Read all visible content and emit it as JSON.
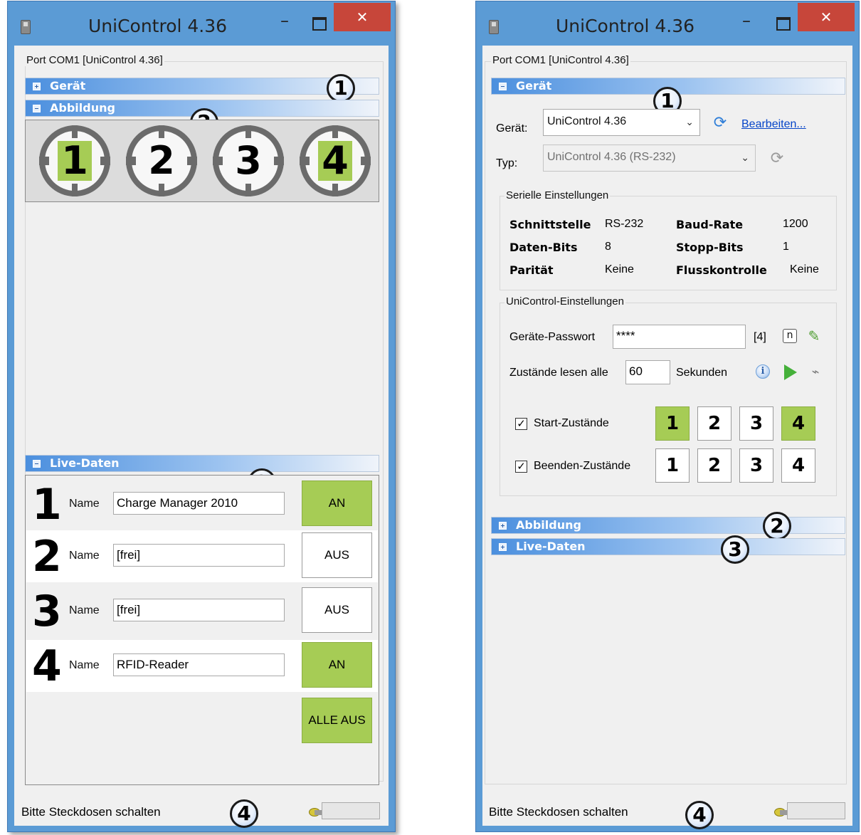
{
  "left_window": {
    "title": "UniControl 4.36",
    "close_glyph": "✕",
    "min_glyph": "–",
    "port_caption": "Port COM1  [UniControl 4.36]",
    "sections": {
      "geraet": "Gerät",
      "abbildung": "Abbildung",
      "live_daten": "Live-Daten"
    },
    "sockets": [
      {
        "num": "1",
        "state": "on"
      },
      {
        "num": "2",
        "state": "off"
      },
      {
        "num": "3",
        "state": "off"
      },
      {
        "num": "4",
        "state": "on"
      }
    ],
    "live_rows": [
      {
        "num": "1",
        "label": "Name",
        "value": "Charge Manager 2010",
        "button": "AN",
        "state": "on"
      },
      {
        "num": "2",
        "label": "Name",
        "value": "[frei]",
        "button": "AUS",
        "state": "off"
      },
      {
        "num": "3",
        "label": "Name",
        "value": "[frei]",
        "button": "AUS",
        "state": "off"
      },
      {
        "num": "4",
        "label": "Name",
        "value": "RFID-Reader",
        "button": "AN",
        "state": "on"
      }
    ],
    "all_off_button": "ALLE AUS",
    "status_text": "Bitte Steckdosen schalten",
    "callouts": [
      "1",
      "2",
      "3",
      "4"
    ]
  },
  "right_window": {
    "title": "UniControl 4.36",
    "close_glyph": "✕",
    "min_glyph": "–",
    "port_caption": "Port COM1  [UniControl 4.36]",
    "sections": {
      "geraet": "Gerät",
      "abbildung": "Abbildung",
      "live_daten": "Live-Daten"
    },
    "device": {
      "label": "Gerät:",
      "value": "UniControl 4.36",
      "edit_link": "Bearbeiten..."
    },
    "type": {
      "label": "Typ:",
      "value": "UniControl 4.36 (RS-232)"
    },
    "serial": {
      "caption": "Serielle Einstellungen",
      "interface_key": "Schnittstelle",
      "interface_val": "RS-232",
      "baud_key": "Baud-Rate",
      "baud_val": "1200",
      "databits_key": "Daten-Bits",
      "databits_val": "8",
      "stopbits_key": "Stopp-Bits",
      "stopbits_val": "1",
      "parity_key": "Parität",
      "parity_val": "Keine",
      "flow_key": "Flusskontrolle",
      "flow_val": "Keine"
    },
    "unicontrol": {
      "caption": "UniControl-Einstellungen",
      "password_label": "Geräte-Passwort",
      "password_value": "****",
      "password_len": "[4]",
      "n_badge": "n",
      "read_label": "Zustände lesen alle",
      "read_value": "60",
      "read_unit": "Sekunden",
      "start_label": "Start-Zustände",
      "end_label": "Beenden-Zustände",
      "check_glyph": "✓",
      "start_states": [
        {
          "num": "1",
          "state": "on"
        },
        {
          "num": "2",
          "state": "off"
        },
        {
          "num": "3",
          "state": "off"
        },
        {
          "num": "4",
          "state": "on"
        }
      ],
      "end_states": [
        {
          "num": "1",
          "state": "off"
        },
        {
          "num": "2",
          "state": "off"
        },
        {
          "num": "3",
          "state": "off"
        },
        {
          "num": "4",
          "state": "off"
        }
      ]
    },
    "status_text": "Bitte Steckdosen schalten",
    "callouts": [
      "1",
      "2",
      "3",
      "4"
    ]
  },
  "icons": {
    "refresh": "⟳",
    "pencil": "✎",
    "plug": "⌁",
    "info": "i",
    "dropdown": "⌄"
  },
  "colors": {
    "window_frame": "#5b9bd5",
    "client_bg": "#f0f0f0",
    "on_green": "#a6cc55",
    "close_red": "#c7463a",
    "section_blue": "#4b8fde",
    "link_blue": "#0645c8"
  }
}
